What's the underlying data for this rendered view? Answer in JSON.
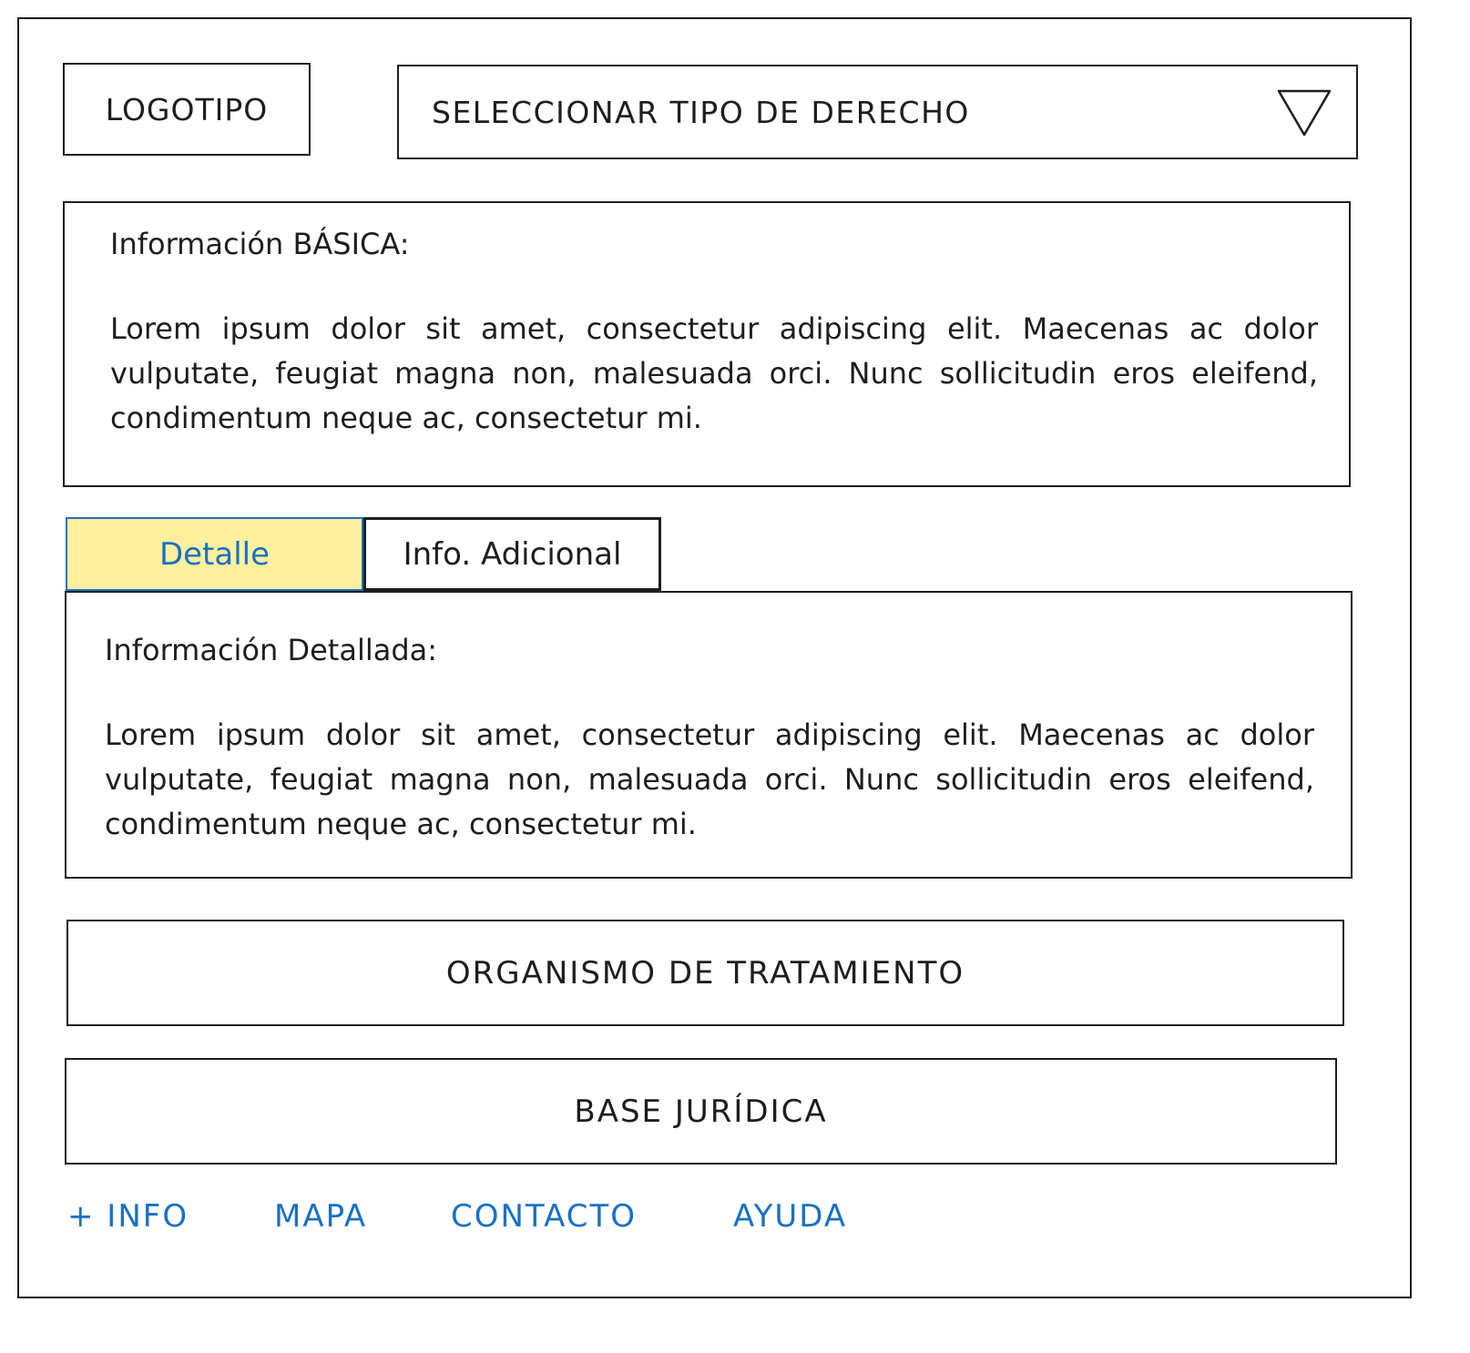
{
  "header": {
    "logo_label": "LOGOTIPO",
    "select_label": "SELECCIONAR TIPO DE DERECHO",
    "select_icon": "triangle-down-icon"
  },
  "basic_info": {
    "title": "Información BÁSICA:",
    "body": "Lorem ipsum dolor sit amet, consectetur adipiscing elit. Maecenas ac dolor vulputate, feugiat magna non, malesuada orci. Nunc sollicitudin eros eleifend, condimentum neque ac, consectetur mi."
  },
  "tabs": [
    {
      "label": "Detalle",
      "active": true
    },
    {
      "label": "Info. Adicional",
      "active": false
    }
  ],
  "detail_panel": {
    "title": "Información Detallada:",
    "body": "Lorem ipsum dolor sit amet, consectetur adipiscing elit. Maecenas ac dolor vulputate, feugiat magna non, malesuada orci. Nunc sollicitudin eros eleifend, condimentum neque ac, consectetur mi."
  },
  "sections": {
    "organismo_label": "ORGANISMO DE TRATAMIENTO",
    "base_label": "BASE JURÍDICA"
  },
  "footer": {
    "links": [
      "+ INFO",
      "MAPA",
      "CONTACTO",
      "AYUDA"
    ]
  },
  "colors": {
    "stroke": "#1e1e1e",
    "accent_blue": "#1971c2",
    "active_tab_fill": "#fff0a0"
  }
}
